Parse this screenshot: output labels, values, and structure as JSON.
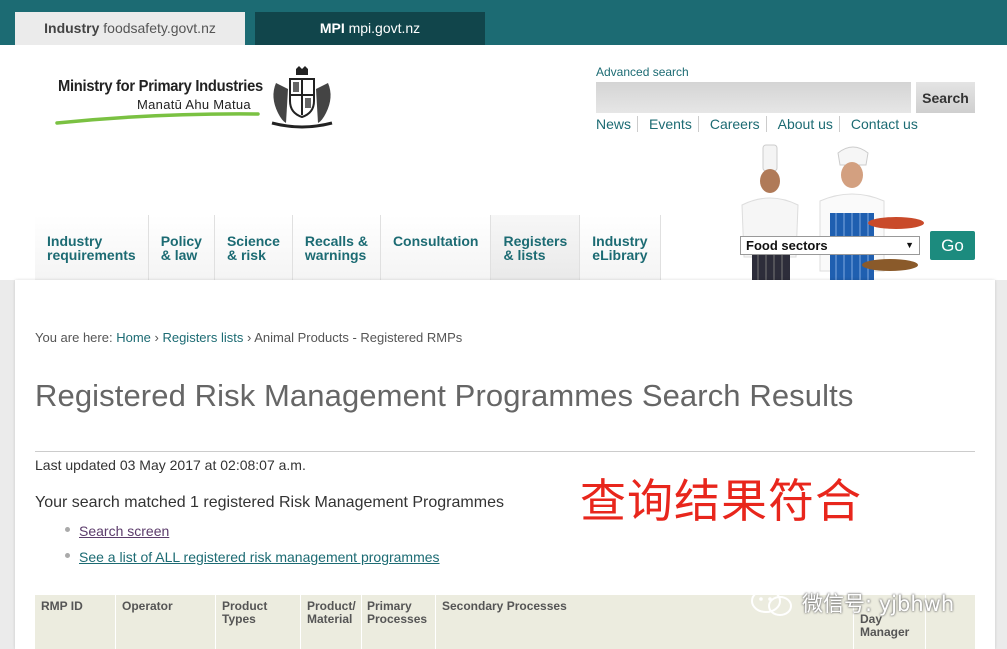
{
  "tabs": {
    "industry_bold": "Industry",
    "industry_rest": " foodsafety.govt.nz",
    "mpi_bold": "MPI",
    "mpi_rest": " mpi.govt.nz"
  },
  "logo": {
    "line1": "Ministry for Primary Industries",
    "line2": "Manatū Ahu Matua"
  },
  "search": {
    "advanced_label": "Advanced search",
    "input_value": "",
    "button_label": "Search"
  },
  "top_links": [
    "News",
    "Events",
    "Careers",
    "About us",
    "Contact us"
  ],
  "nav": [
    "Industry\nrequirements",
    "Policy\n& law",
    "Science\n& risk",
    "Recalls &\nwarnings",
    "Consultation",
    "Registers\n& lists",
    "Industry\neLibrary"
  ],
  "nav_active_index": 5,
  "sector": {
    "selected": "Food sectors",
    "go_label": "Go"
  },
  "breadcrumb": {
    "prefix": "You are here: ",
    "home": "Home",
    "sep": " › ",
    "registers": "Registers lists",
    "current": "Animal Products - Registered RMPs"
  },
  "page_title": "Registered Risk Management Programmes Search Results",
  "last_updated": "Last updated 03 May 2017 at 02:08:07 a.m.",
  "overlay_text": "查询结果符合",
  "matched_text": "Your search matched 1 registered Risk Management Programmes",
  "result_links": [
    "Search screen",
    "See a list of ALL registered risk management programmes"
  ],
  "table_headers": [
    "RMP ID",
    "Operator",
    "Product\nTypes",
    "Product/\nMaterial",
    "Primary\nProcesses",
    "Secondary Processes",
    "Day\nManager"
  ],
  "watermark": "微信号: yjbhwh",
  "colors": {
    "brand_teal": "#1c6b73",
    "top_bar": "#1c6b73",
    "go_button": "#1c8b7e",
    "overlay_red": "#e8261c",
    "logo_green": "#7ac142"
  }
}
